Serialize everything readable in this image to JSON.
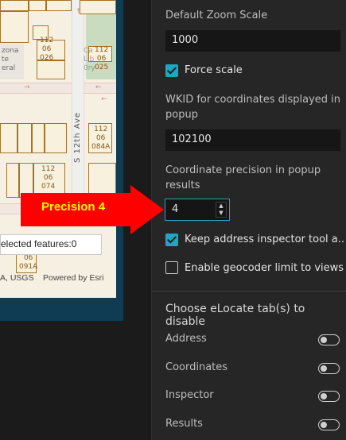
{
  "map": {
    "parcels": [
      {
        "id": "p1",
        "label": "112\n06\n026"
      },
      {
        "id": "p2",
        "label": "112\n06\n025"
      },
      {
        "id": "p3",
        "label": "112\n06\n084A"
      },
      {
        "id": "p4",
        "label": "112\n06\n074"
      },
      {
        "id": "p5",
        "label": "06\n091A"
      }
    ],
    "place_label_1": "zona\nte\neral",
    "place_label_2": "Ca\nLib\n0ry",
    "street_label": "S 12th Ave",
    "selected_features": "elected features:0",
    "attribution_left": "A, USGS",
    "attribution_right": "Powered by Esri"
  },
  "callout": {
    "text": "Precision 4",
    "color": "#ff0000",
    "text_color": "#ffff00"
  },
  "panel": {
    "zoom_scale": {
      "label": "Default Zoom Scale",
      "value": "1000"
    },
    "force_scale": {
      "label": "Force scale",
      "checked": true
    },
    "wkid": {
      "label": "WKID for coordinates displayed in popup",
      "value": "102100"
    },
    "precision": {
      "label": "Coordinate precision in popup results",
      "value": "4"
    },
    "keep_inspector": {
      "label": "Keep address inspector tool a...",
      "checked": true
    },
    "geocoder_limit": {
      "label": "Enable geocoder limit to views...",
      "checked": false
    },
    "elocate_section": {
      "title": "Choose eLocate tab(s) to disable",
      "tabs": [
        {
          "label": "Address",
          "enabled": false
        },
        {
          "label": "Coordinates",
          "enabled": false
        },
        {
          "label": "Inspector",
          "enabled": false
        },
        {
          "label": "Results",
          "enabled": false
        }
      ]
    },
    "accent_color": "#1fa7c1"
  }
}
